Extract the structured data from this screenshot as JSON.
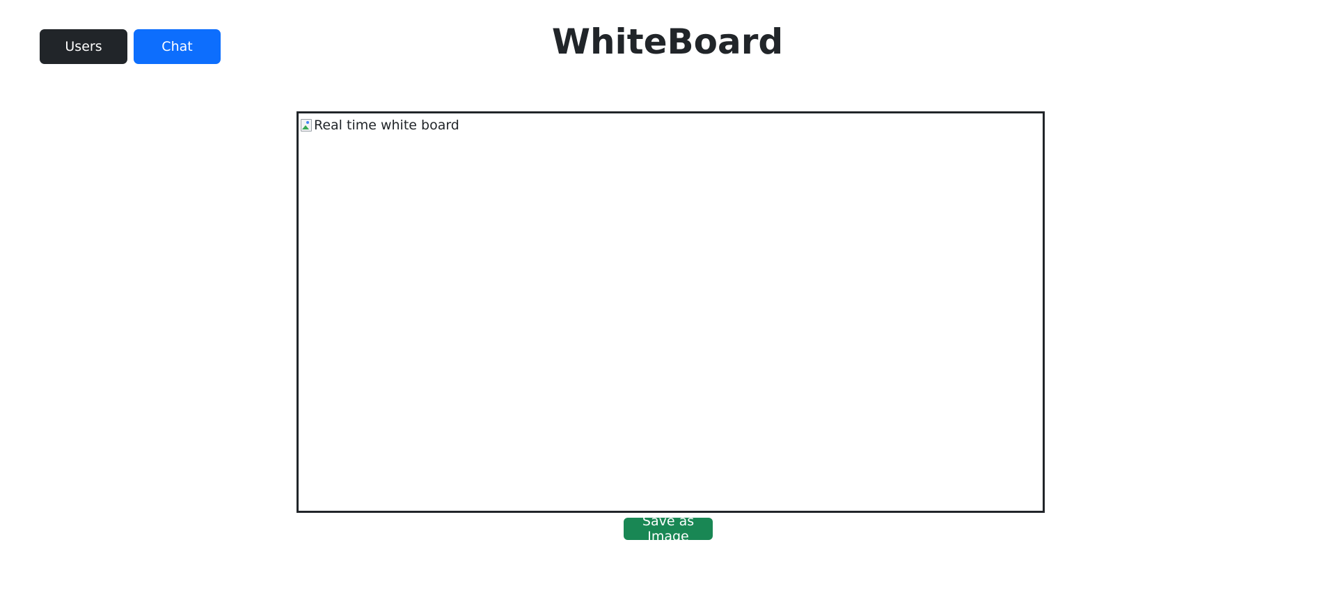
{
  "header": {
    "users_label": "Users",
    "chat_label": "Chat",
    "title": "WhiteBoard"
  },
  "board": {
    "image_alt": "Real time white board",
    "icon": "broken-image-icon"
  },
  "actions": {
    "save_label": "Save as Image"
  },
  "colors": {
    "users_button": "#212529",
    "chat_button": "#0d6efd",
    "save_button": "#198754",
    "board_border": "#212529",
    "text": "#212529"
  }
}
